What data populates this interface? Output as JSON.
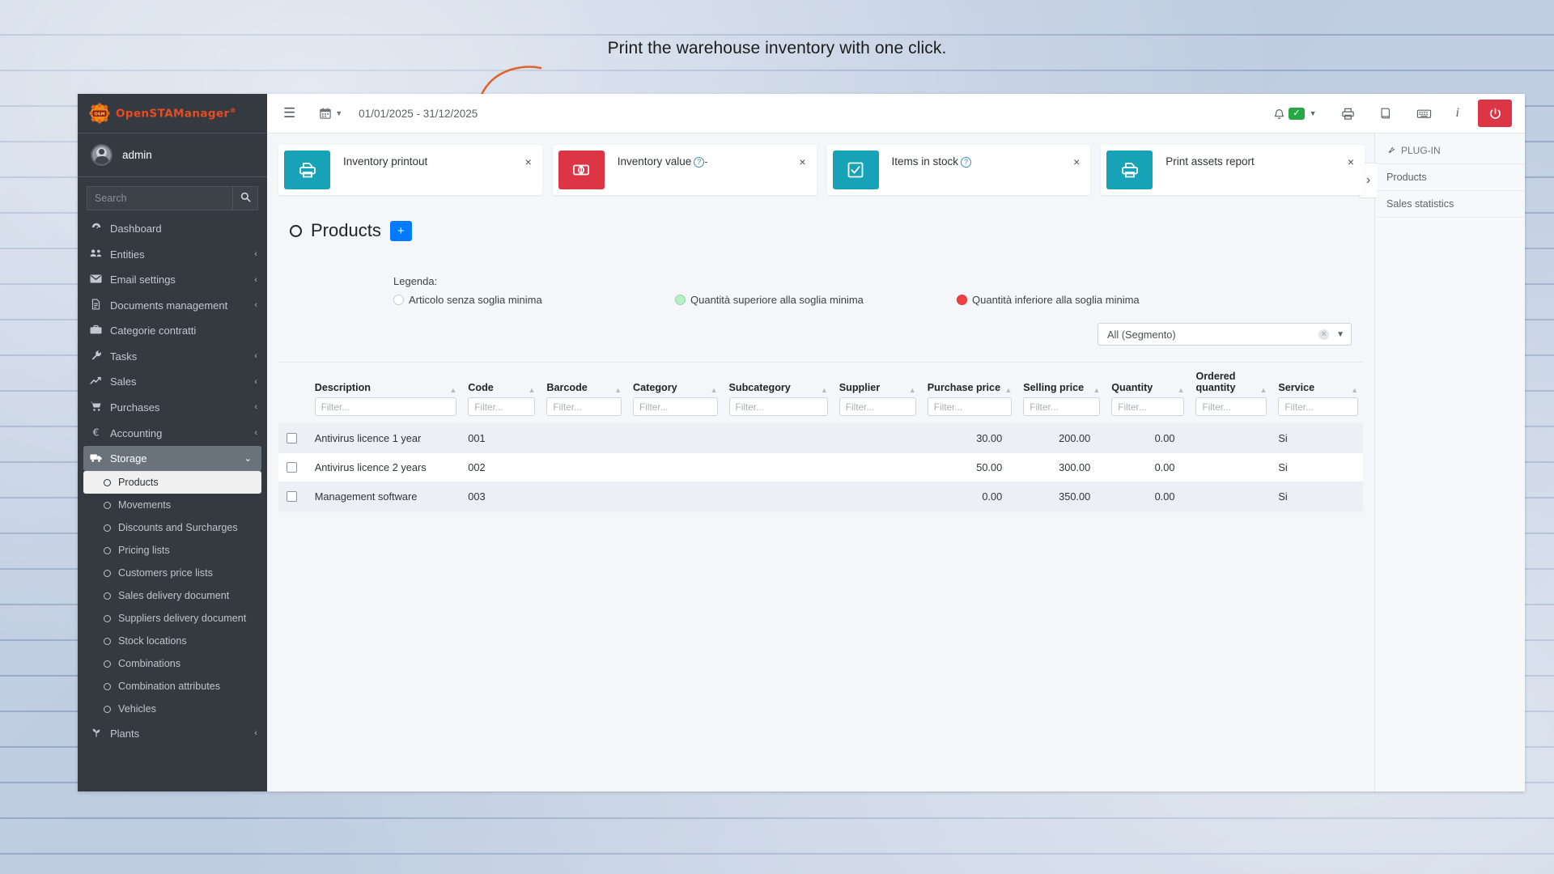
{
  "annotation": {
    "text": "Print the warehouse inventory with one click."
  },
  "brand": {
    "name": "OpenSTAManager",
    "trademark": "®",
    "logo_icon": "gear-logo-icon"
  },
  "sidebar": {
    "user": {
      "name": "admin",
      "avatar_icon": "avatar-icon"
    },
    "search": {
      "value": "",
      "placeholder": "Search",
      "button_icon": "search-icon"
    },
    "items": [
      {
        "label": "Dashboard",
        "icon": "dashboard-icon",
        "caret": ""
      },
      {
        "label": "Entities",
        "icon": "users-icon",
        "caret": "‹"
      },
      {
        "label": "Email settings",
        "icon": "envelope-icon",
        "caret": "‹"
      },
      {
        "label": "Documents management",
        "icon": "file-icon",
        "caret": "‹"
      },
      {
        "label": "Categorie contratti",
        "icon": "briefcase-icon",
        "caret": ""
      },
      {
        "label": "Tasks",
        "icon": "wrench-icon",
        "caret": "‹"
      },
      {
        "label": "Sales",
        "icon": "chart-line-icon",
        "caret": "‹"
      },
      {
        "label": "Purchases",
        "icon": "cart-icon",
        "caret": "‹"
      },
      {
        "label": "Accounting",
        "icon": "euro-icon",
        "caret": "‹"
      },
      {
        "label": "Storage",
        "icon": "truck-icon",
        "caret": "⌄",
        "active": true
      },
      {
        "label": "Plants",
        "icon": "plant-icon",
        "caret": "‹"
      }
    ],
    "storage_subitems": [
      {
        "label": "Products",
        "current": true
      },
      {
        "label": "Movements"
      },
      {
        "label": "Discounts and Surcharges"
      },
      {
        "label": "Pricing lists"
      },
      {
        "label": "Customers price lists"
      },
      {
        "label": "Sales delivery document"
      },
      {
        "label": "Suppliers delivery document"
      },
      {
        "label": "Stock locations"
      },
      {
        "label": "Combinations"
      },
      {
        "label": "Combination attributes"
      },
      {
        "label": "Vehicles"
      }
    ]
  },
  "topbar": {
    "menu_icon": "hamburger-icon",
    "calendar_icon": "calendar-icon",
    "date_range": "01/01/2025 - 31/12/2025",
    "icons": [
      {
        "name": "bell-icon",
        "glyph": "🔔"
      },
      {
        "name": "printer-icon",
        "glyph": "⎙"
      },
      {
        "name": "book-icon",
        "glyph": "📕"
      },
      {
        "name": "keyboard-icon",
        "glyph": "⌨"
      },
      {
        "name": "info-icon",
        "glyph": "i"
      }
    ],
    "notification_badge": "✓",
    "power_icon": "power-icon"
  },
  "plugin_panel": {
    "header": "PLUG-IN",
    "header_icon": "plug-icon",
    "items": [
      {
        "label": "Products"
      },
      {
        "label": "Sales statistics"
      }
    ],
    "toggle_icon": "chevron-right-icon"
  },
  "cards": [
    {
      "title": "Inventory printout",
      "value": "",
      "icon": "printer-icon",
      "color": "#17a2b8",
      "help": false,
      "close": "×"
    },
    {
      "title": "Inventory value",
      "value": "-",
      "icon": "money-icon",
      "color": "#dc3545",
      "help": true,
      "close": "×"
    },
    {
      "title": "Items in stock",
      "value": "",
      "icon": "check-square-icon",
      "color": "#17a2b8",
      "help": true,
      "close": "×"
    },
    {
      "title": "Print assets report",
      "value": "",
      "icon": "printer-icon",
      "color": "#17a2b8",
      "help": false,
      "close": "×"
    }
  ],
  "page": {
    "title": "Products",
    "title_icon": "circle-icon",
    "add_label": "+"
  },
  "legend": {
    "title": "Legenda:",
    "entries": [
      {
        "label": "Articolo senza soglia minima",
        "color": "#ffffff"
      },
      {
        "label": "Quantità superiore alla soglia minima",
        "color": "#b9efc3"
      },
      {
        "label": "Quantità inferiore alla soglia minima",
        "color": "#ef3f3f"
      }
    ]
  },
  "segment": {
    "value": "All (Segmento)",
    "clear_icon": "clear-icon",
    "caret_icon": "chevron-down-icon"
  },
  "table": {
    "filter_placeholder": "Filter...",
    "columns": [
      {
        "label": "Description",
        "align": "left"
      },
      {
        "label": "Code",
        "align": "left"
      },
      {
        "label": "Barcode",
        "align": "left"
      },
      {
        "label": "Category",
        "align": "left"
      },
      {
        "label": "Subcategory",
        "align": "left"
      },
      {
        "label": "Supplier",
        "align": "left"
      },
      {
        "label": "Purchase price",
        "align": "right"
      },
      {
        "label": "Selling price",
        "align": "right"
      },
      {
        "label": "Quantity",
        "align": "right"
      },
      {
        "label": "Ordered quantity",
        "align": "right"
      },
      {
        "label": "Service",
        "align": "left"
      }
    ],
    "rows": [
      {
        "description": "Antivirus licence 1 year",
        "code": "001",
        "barcode": "",
        "category": "",
        "subcategory": "",
        "supplier": "",
        "purchase_price": "30.00",
        "selling_price": "200.00",
        "quantity": "0.00",
        "ordered_quantity": "",
        "service": "Si"
      },
      {
        "description": "Antivirus licence 2 years",
        "code": "002",
        "barcode": "",
        "category": "",
        "subcategory": "",
        "supplier": "",
        "purchase_price": "50.00",
        "selling_price": "300.00",
        "quantity": "0.00",
        "ordered_quantity": "",
        "service": "Si"
      },
      {
        "description": "Management software",
        "code": "003",
        "barcode": "",
        "category": "",
        "subcategory": "",
        "supplier": "",
        "purchase_price": "0.00",
        "selling_price": "350.00",
        "quantity": "0.00",
        "ordered_quantity": "",
        "service": "Si"
      }
    ]
  },
  "colors": {
    "accent_teal": "#17a2b8",
    "accent_red": "#dc3545",
    "accent_blue": "#007bff",
    "sidebar_bg": "#343a40",
    "annotation_orange": "#e2622b"
  }
}
